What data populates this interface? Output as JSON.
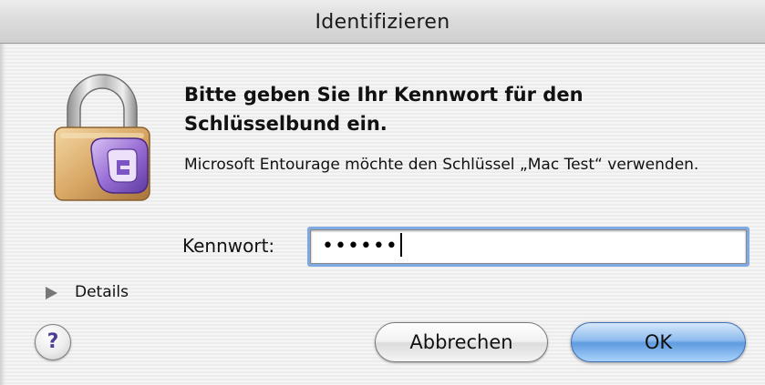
{
  "window": {
    "title": "Identifizieren"
  },
  "dialog": {
    "heading": "Bitte geben Sie Ihr Kennwort für den Schlüsselbund ein.",
    "message": "Microsoft Entourage möchte den Schlüssel „Mac Test“ verwenden.",
    "icon": "keychain-lock-entourage-icon"
  },
  "password": {
    "label": "Kennwort:",
    "masked_value": "••••••"
  },
  "details": {
    "label": "Details",
    "icon": "disclosure-triangle-right-icon"
  },
  "buttons": {
    "help_label": "?",
    "cancel_label": "Abbrechen",
    "ok_label": "OK"
  },
  "colors": {
    "default_button": "#5e9be0",
    "focus_ring": "#7fa9e2",
    "help_glyph": "#4a3f96"
  }
}
